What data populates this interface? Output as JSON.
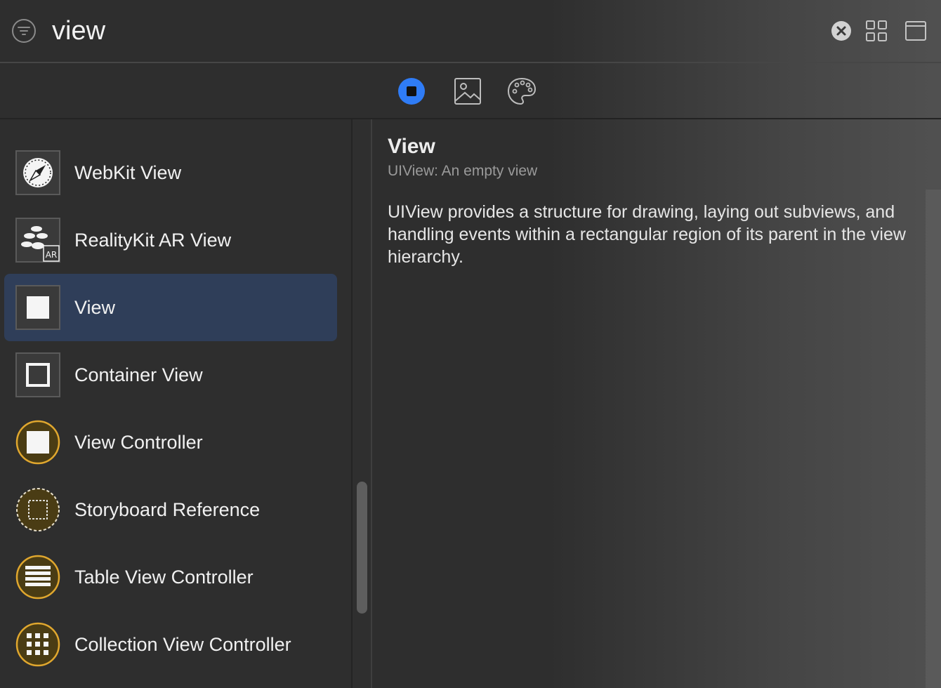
{
  "search": {
    "value": "view",
    "clear_icon": "xmark-circle-icon",
    "filter_icon": "filter-icon"
  },
  "toolbar": {
    "icons": [
      "objects-icon",
      "media-icon",
      "color-palette-icon"
    ],
    "selected_color": "#2f7cf6"
  },
  "library": {
    "items": [
      {
        "label": "",
        "icon": "partial-icon"
      },
      {
        "label": "WebKit View",
        "icon": "compass-icon"
      },
      {
        "label": "RealityKit AR View",
        "icon": "ar-icon"
      },
      {
        "label": "View",
        "icon": "filled-square-icon",
        "selected": true
      },
      {
        "label": "Container View",
        "icon": "outline-square-icon"
      },
      {
        "label": "View Controller",
        "icon": "view-controller-icon"
      },
      {
        "label": "Storyboard Reference",
        "icon": "storyboard-reference-icon"
      },
      {
        "label": "Table View Controller",
        "icon": "table-view-controller-icon"
      },
      {
        "label": "Collection View Controller",
        "icon": "collection-view-controller-icon"
      }
    ],
    "selected_bg": "#2f3e59",
    "controller_accent": "#e0a72e"
  },
  "detail": {
    "title": "View",
    "subtitle": "UIView: An empty view",
    "body": "UIView provides a structure for drawing, laying out subviews, and handling events within a rectangular region of its parent in the view hierarchy."
  }
}
